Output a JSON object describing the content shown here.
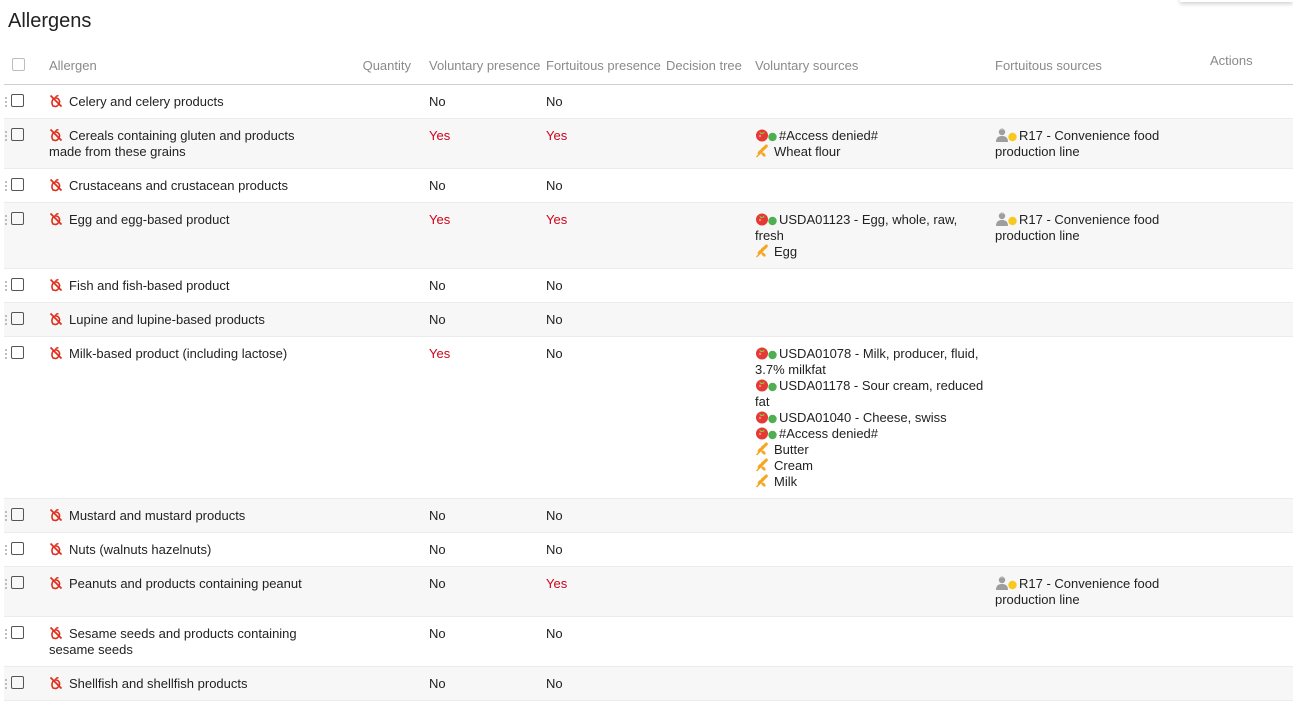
{
  "page": {
    "title": "Allergens"
  },
  "columns": {
    "allergen": "Allergen",
    "quantity": "Quantity",
    "voluntary_presence": "Voluntary presence",
    "fortuitous_presence": "Fortuitous presence",
    "decision_tree": "Decision tree",
    "voluntary_sources": "Voluntary sources",
    "fortuitous_sources": "Fortuitous sources",
    "actions": "Actions"
  },
  "icons": {
    "allergen": "allergen-strikethrough-icon",
    "raw_material": "raw-material-tomato-icon",
    "ingredient": "ingredient-wheat-icon",
    "production_line": "production-line-person-icon"
  },
  "colors": {
    "yes": "#d0021b",
    "allergen_icon": "#e0301e",
    "wheat": "#f5a623",
    "status_green": "#4caf50",
    "status_yellow": "#f8c81c"
  },
  "rows": [
    {
      "name": "Celery and celery products",
      "voluntary": "No",
      "fortuitous": "No",
      "voluntary_sources": [],
      "fortuitous_sources": []
    },
    {
      "name": "Cereals containing gluten and products made from these grains",
      "voluntary": "Yes",
      "fortuitous": "Yes",
      "voluntary_sources": [
        {
          "type": "raw",
          "text": "#Access denied#"
        },
        {
          "type": "ingredient",
          "text": "Wheat flour"
        }
      ],
      "fortuitous_sources": [
        {
          "type": "line",
          "text": "R17 - Convenience food production line"
        }
      ]
    },
    {
      "name": "Crustaceans and crustacean products",
      "voluntary": "No",
      "fortuitous": "No",
      "voluntary_sources": [],
      "fortuitous_sources": []
    },
    {
      "name": "Egg and egg-based product",
      "voluntary": "Yes",
      "fortuitous": "Yes",
      "voluntary_sources": [
        {
          "type": "raw",
          "text": "USDA01123 - Egg, whole, raw, fresh"
        },
        {
          "type": "ingredient",
          "text": "Egg"
        }
      ],
      "fortuitous_sources": [
        {
          "type": "line",
          "text": "R17 - Convenience food production line"
        }
      ]
    },
    {
      "name": "Fish and fish-based product",
      "voluntary": "No",
      "fortuitous": "No",
      "voluntary_sources": [],
      "fortuitous_sources": []
    },
    {
      "name": "Lupine and lupine-based products",
      "voluntary": "No",
      "fortuitous": "No",
      "voluntary_sources": [],
      "fortuitous_sources": []
    },
    {
      "name": "Milk-based product (including lactose)",
      "voluntary": "Yes",
      "fortuitous": "No",
      "voluntary_sources": [
        {
          "type": "raw",
          "text": "USDA01078 - Milk, producer, fluid, 3.7% milkfat"
        },
        {
          "type": "raw",
          "text": "USDA01178 - Sour cream, reduced fat"
        },
        {
          "type": "raw",
          "text": "USDA01040 - Cheese, swiss"
        },
        {
          "type": "raw",
          "text": "#Access denied#"
        },
        {
          "type": "ingredient",
          "text": "Butter"
        },
        {
          "type": "ingredient",
          "text": "Cream"
        },
        {
          "type": "ingredient",
          "text": "Milk"
        }
      ],
      "fortuitous_sources": []
    },
    {
      "name": "Mustard and mustard products",
      "voluntary": "No",
      "fortuitous": "No",
      "voluntary_sources": [],
      "fortuitous_sources": []
    },
    {
      "name": "Nuts (walnuts hazelnuts)",
      "voluntary": "No",
      "fortuitous": "No",
      "voluntary_sources": [],
      "fortuitous_sources": []
    },
    {
      "name": "Peanuts and products containing peanut",
      "voluntary": "No",
      "fortuitous": "Yes",
      "voluntary_sources": [],
      "fortuitous_sources": [
        {
          "type": "line",
          "text": "R17 - Convenience food production line"
        }
      ]
    },
    {
      "name": "Sesame seeds and products containing sesame seeds",
      "voluntary": "No",
      "fortuitous": "No",
      "voluntary_sources": [],
      "fortuitous_sources": []
    },
    {
      "name": "Shellfish and shellfish products",
      "voluntary": "No",
      "fortuitous": "No",
      "voluntary_sources": [],
      "fortuitous_sources": []
    }
  ]
}
